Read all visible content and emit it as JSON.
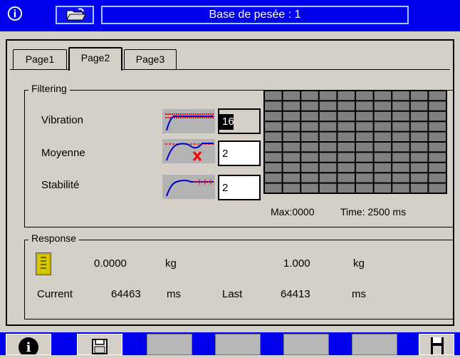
{
  "header": {
    "title": "Base de pesée : 1"
  },
  "tabs": [
    {
      "label": "Page1",
      "active": false
    },
    {
      "label": "Page2",
      "active": true
    },
    {
      "label": "Page3",
      "active": false
    }
  ],
  "filtering": {
    "title": "Filtering",
    "rows": [
      {
        "label": "Vibration",
        "value": "16"
      },
      {
        "label": "Moyenne",
        "value": "2"
      },
      {
        "label": "Stabilité",
        "value": "2"
      }
    ],
    "chart": {
      "max_text": "Max:0000",
      "time_text": "Time: 2500 ms"
    }
  },
  "response": {
    "title": "Response",
    "value1": "0.0000",
    "unit1": "kg",
    "value2": "1.000",
    "unit2": "kg",
    "current_label": "Current",
    "current_value": "64463",
    "current_unit": "ms",
    "last_label": "Last",
    "last_value": "64413",
    "last_unit": "ms"
  },
  "colors": {
    "titlebar": "#0000ee",
    "accent_blue": "#0000cc",
    "grid_cells": "#808080",
    "grid_lines": "#000000",
    "icon_background": "#b3b3b3",
    "signal_red": "#ff0000"
  },
  "icons": [
    "person-icon",
    "folder-open-icon",
    "info-icon",
    "save-icon",
    "floppy-disk-icon",
    "weight-sensor-icon"
  ]
}
